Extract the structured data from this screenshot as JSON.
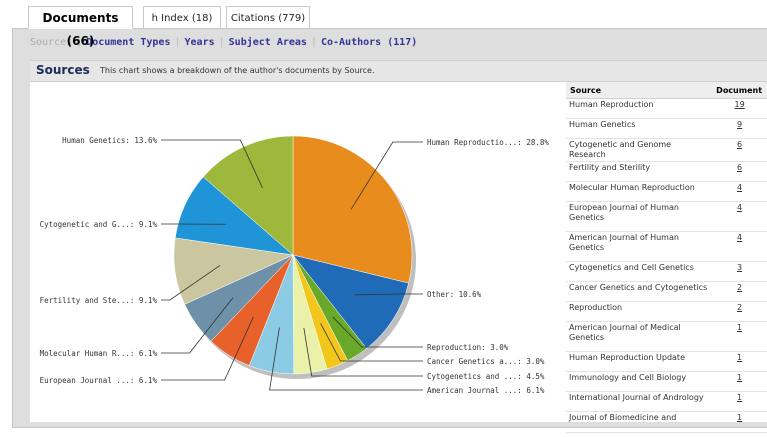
{
  "tabs": [
    {
      "label": "Documents (66)"
    },
    {
      "label": "h Index (18)"
    },
    {
      "label": "Citations (779)"
    }
  ],
  "subnav": {
    "sources": "Sources",
    "document_types": "Document Types",
    "years": "Years",
    "subject_areas": "Subject Areas",
    "coauthors": "Co-Authors (117)"
  },
  "section": {
    "title": "Sources",
    "description": "This chart shows a breakdown of the author's documents by Source."
  },
  "table": {
    "headers": [
      "Source",
      "Document"
    ],
    "rows": [
      {
        "source": "Human Reproduction",
        "count": "19"
      },
      {
        "source": "Human Genetics",
        "count": "9"
      },
      {
        "source": "Cytogenetic and Genome Research",
        "count": "6"
      },
      {
        "source": "Fertility and Sterility",
        "count": "6"
      },
      {
        "source": "Molecular Human Reproduction",
        "count": "4"
      },
      {
        "source": "European Journal of Human Genetics",
        "count": "4"
      },
      {
        "source": "American Journal of Human Genetics",
        "count": "4"
      },
      {
        "source": "Cytogenetics and Cell Genetics",
        "count": "3"
      },
      {
        "source": "Cancer Genetics and Cytogenetics",
        "count": "2"
      },
      {
        "source": "Reproduction",
        "count": "2"
      },
      {
        "source": "American Journal of Medical Genetics",
        "count": "1"
      },
      {
        "source": "Human Reproduction Update",
        "count": "1"
      },
      {
        "source": "Immunology and Cell Biology",
        "count": "1"
      },
      {
        "source": "International Journal of Andrology",
        "count": "1"
      },
      {
        "source": "Journal of Biomedicine and",
        "count": "1"
      }
    ]
  },
  "chart_data": {
    "type": "pie",
    "slices": [
      {
        "label": "Human Reproductio...: 28.8%",
        "value": 28.8,
        "color": "#e88c1e"
      },
      {
        "label": "Other: 10.6%",
        "value": 10.6,
        "color": "#1f6bb8"
      },
      {
        "label": "Reproduction: 3.0%",
        "value": 3.0,
        "color": "#6aa82a"
      },
      {
        "label": "Cancer Genetics a...: 3.0%",
        "value": 3.0,
        "color": "#f3c61c"
      },
      {
        "label": "Cytogenetics and ...: 4.5%",
        "value": 4.5,
        "color": "#e9f2a8"
      },
      {
        "label": "American Journal ...: 6.1%",
        "value": 6.1,
        "color": "#8ccbe4"
      },
      {
        "label": "European Journal ...: 6.1%",
        "value": 6.1,
        "color": "#e8602a"
      },
      {
        "label": "Molecular Human R...: 6.1%",
        "value": 6.1,
        "color": "#6e90a8"
      },
      {
        "label": "Fertility and Ste...: 9.1%",
        "value": 9.1,
        "color": "#c9c6a0"
      },
      {
        "label": "Cytogenetic and G...: 9.1%",
        "value": 9.1,
        "color": "#1f95d8"
      },
      {
        "label": "Human Genetics: 13.6%",
        "value": 13.6,
        "color": "#9db83a"
      }
    ]
  }
}
